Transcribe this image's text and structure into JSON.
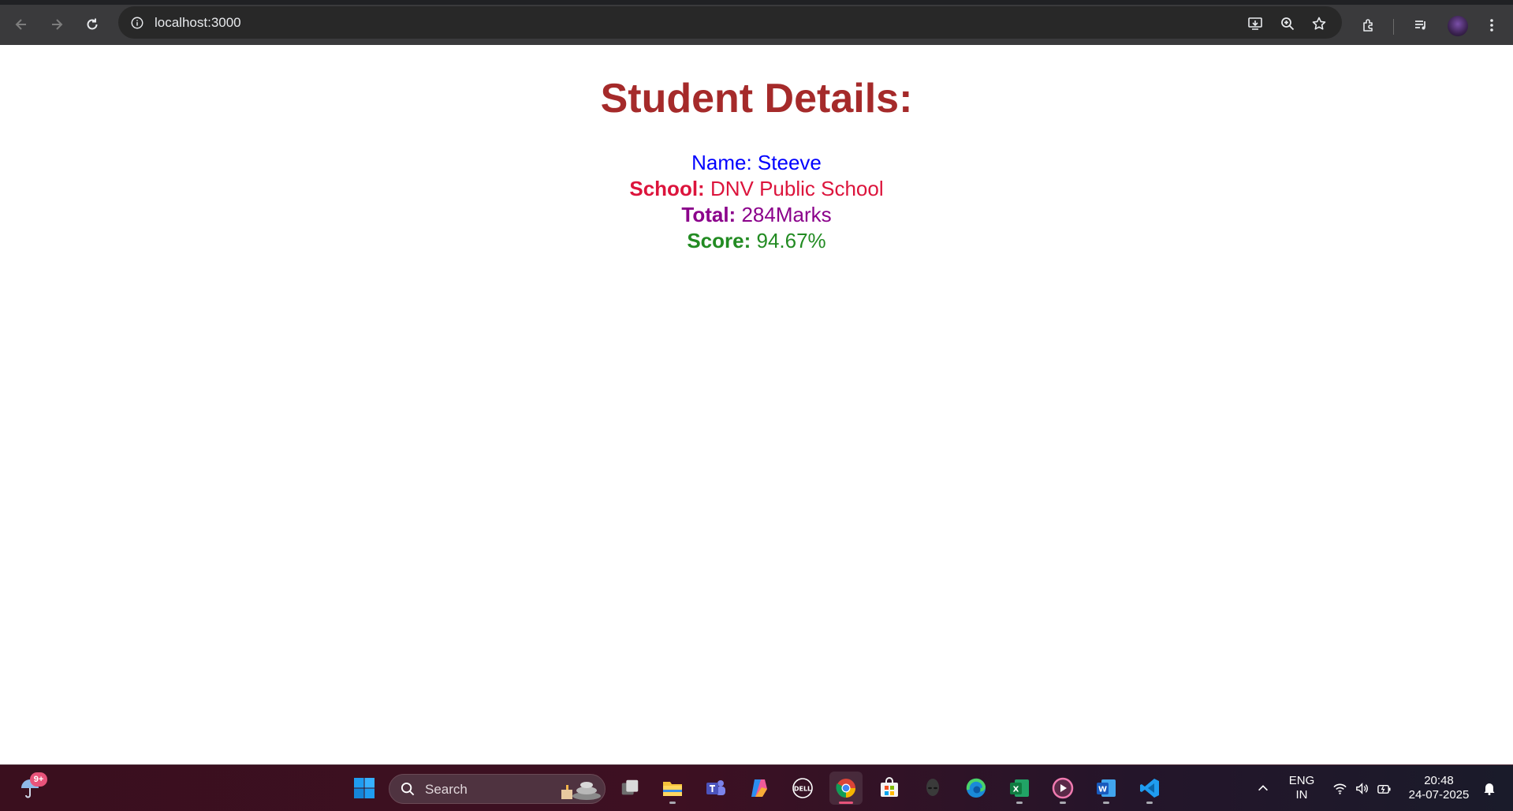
{
  "browser": {
    "url": "localhost:3000"
  },
  "page": {
    "title": "Student Details:",
    "details": {
      "name_label": "Name:",
      "name_value": "Steeve",
      "school_label": "School:",
      "school_value": "DNV Public School",
      "total_label": "Total:",
      "total_value": "284Marks",
      "score_label": "Score:",
      "score_value": "94.67%"
    }
  },
  "colors": {
    "title": "#a52a2a",
    "name": "#0000ff",
    "school": "#dc143c",
    "total": "#8b008b",
    "score": "#228b22"
  },
  "taskbar": {
    "weather_badge": "9+",
    "search_label": "Search",
    "apps": [
      "widgets",
      "start",
      "search",
      "task-view",
      "file-explorer",
      "teams",
      "copilot",
      "dell",
      "chrome",
      "microsoft-store",
      "alienware",
      "edge",
      "excel",
      "media-player",
      "word",
      "vscode"
    ],
    "lang_primary": "ENG",
    "lang_secondary": "IN",
    "time": "20:48",
    "date": "24-07-2025"
  }
}
